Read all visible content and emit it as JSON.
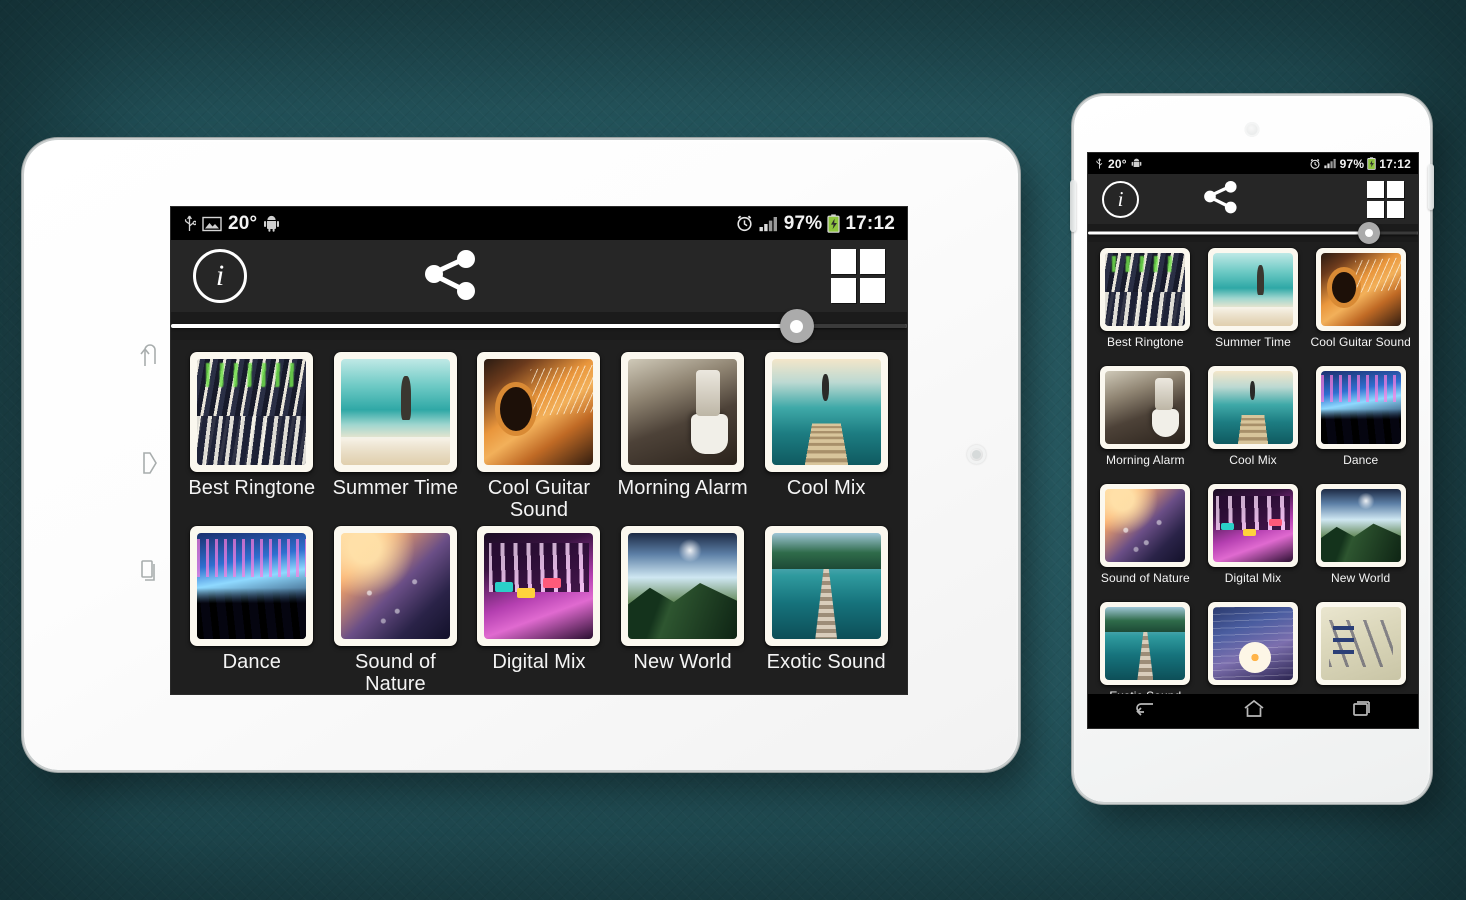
{
  "statusbar": {
    "icons_left": [
      "usb-icon",
      "picture-icon",
      "android-icon"
    ],
    "temperature": "20°",
    "icons_right": [
      "alarm-clock-icon",
      "signal-icon",
      "battery-charging-icon"
    ],
    "battery_percent": "97%",
    "time": "17:12"
  },
  "actionbar": {
    "info_label": "i",
    "info_name": "info-button",
    "share_name": "share-button",
    "grid_name": "grid-view-button"
  },
  "seekbar": {
    "value_percent": 85
  },
  "colors": {
    "background": "#23555c",
    "screen_bg": "#1f1f1f",
    "actionbar_bg": "#262626",
    "statusbar_bg": "#000000",
    "battery_green": "#8ec63f",
    "thumb_frame": "#fbf8ef",
    "slider_thumb": "#ababab"
  },
  "tablet": {
    "grid_columns": 5,
    "items": [
      {
        "label": "Best Ringtone",
        "art": "art-mixer"
      },
      {
        "label": "Summer Time",
        "art": "art-beach"
      },
      {
        "label": "Cool Guitar Sound",
        "art": "art-guitar"
      },
      {
        "label": "Morning Alarm",
        "art": "art-coffee"
      },
      {
        "label": "Cool Mix",
        "art": "art-dock"
      },
      {
        "label": "Dance",
        "art": "art-dance"
      },
      {
        "label": "Sound of Nature",
        "art": "art-nature"
      },
      {
        "label": "Digital Mix",
        "art": "art-digital"
      },
      {
        "label": "New World",
        "art": "art-world"
      },
      {
        "label": "Exotic Sound",
        "art": "art-exotic"
      }
    ],
    "side_buttons": [
      "back-button",
      "home-button",
      "recents-button"
    ]
  },
  "phone": {
    "grid_columns": 3,
    "items": [
      {
        "label": "Best Ringtone",
        "art": "art-mixer"
      },
      {
        "label": "Summer Time",
        "art": "art-beach"
      },
      {
        "label": "Cool Guitar Sound",
        "art": "art-guitar"
      },
      {
        "label": "Morning Alarm",
        "art": "art-coffee"
      },
      {
        "label": "Cool Mix",
        "art": "art-dock"
      },
      {
        "label": "Dance",
        "art": "art-dance"
      },
      {
        "label": "Sound of Nature",
        "art": "art-nature"
      },
      {
        "label": "Digital Mix",
        "art": "art-digital"
      },
      {
        "label": "New World",
        "art": "art-world"
      },
      {
        "label": "Exotic Sound",
        "art": "art-exotic"
      },
      {
        "label": "",
        "art": "art-flower"
      },
      {
        "label": "",
        "art": "art-paper"
      }
    ],
    "navbar": [
      "back-button",
      "home-button",
      "recents-button"
    ]
  }
}
